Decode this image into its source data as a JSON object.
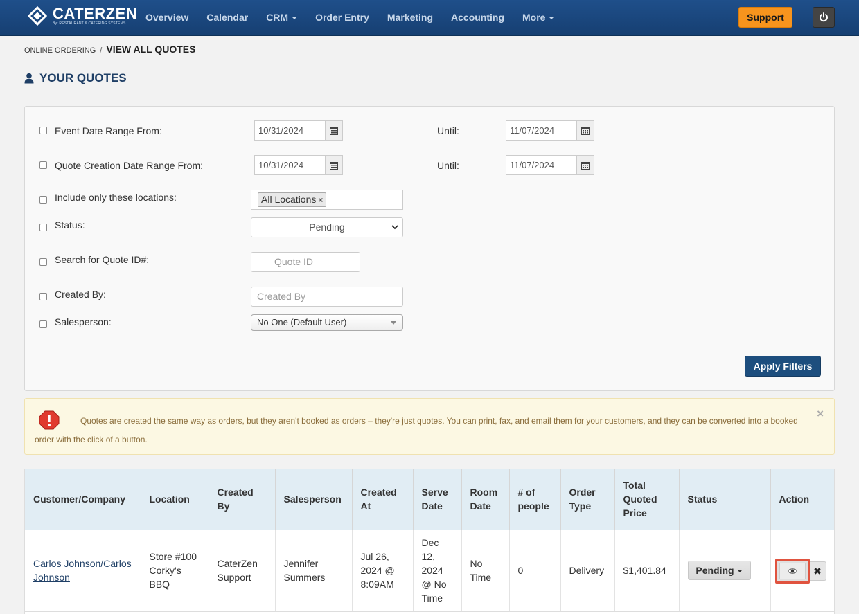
{
  "brand": {
    "name": "CATERZEN",
    "tagline": "By: RESTAURANT & CATERING SYSTEMS"
  },
  "nav": {
    "items": [
      {
        "label": "Overview",
        "dropdown": false
      },
      {
        "label": "Calendar",
        "dropdown": false
      },
      {
        "label": "CRM",
        "dropdown": true
      },
      {
        "label": "Order Entry",
        "dropdown": false
      },
      {
        "label": "Marketing",
        "dropdown": false
      },
      {
        "label": "Accounting",
        "dropdown": false
      },
      {
        "label": "More",
        "dropdown": true
      }
    ],
    "support_label": "Support"
  },
  "breadcrumb": {
    "parent": "ONLINE ORDERING",
    "separator": "/",
    "current": "VIEW ALL QUOTES"
  },
  "page_title": "YOUR QUOTES",
  "filters": {
    "event_date": {
      "label": "Event Date Range From:",
      "from": "10/31/2024",
      "until_label": "Until:",
      "until": "11/07/2024"
    },
    "creation_date": {
      "label": "Quote Creation Date Range From:",
      "from": "10/31/2024",
      "until_label": "Until:",
      "until": "11/07/2024"
    },
    "locations": {
      "label": "Include only these locations:",
      "tag": "All Locations",
      "remove": "×"
    },
    "status": {
      "label": "Status:",
      "value": "Pending"
    },
    "quote_id": {
      "label": "Search for Quote ID#:",
      "placeholder": "Quote ID"
    },
    "created_by": {
      "label": "Created By:",
      "placeholder": "Created By"
    },
    "salesperson": {
      "label": "Salesperson:",
      "value": "No One (Default User)"
    },
    "apply_label": "Apply Filters"
  },
  "alert": {
    "text": "Quotes are created the same way as orders, but they aren't booked as orders – they're just quotes. You can print, fax, and email them for your customers, and they can be converted into a booked order with the click of a button.",
    "close": "×"
  },
  "table": {
    "headers": [
      "Customer/Company",
      "Location",
      "Created By",
      "Salesperson",
      "Created At",
      "Serve Date",
      "Room Date",
      "# of people",
      "Order Type",
      "Total Quoted Price",
      "Status",
      "Action"
    ],
    "rows": [
      {
        "customer": "Carlos Johnson/Carlos Johnson",
        "location": "Store #100 Corky's BBQ",
        "created_by": "CaterZen Support",
        "salesperson": "Jennifer Summers",
        "created_at": "Jul 26, 2024 @ 8:09AM",
        "serve_date": "Dec 12, 2024 @ No Time",
        "room_date": "No Time",
        "people": "0",
        "order_type": "Delivery",
        "total": "$1,401.84",
        "status": "Pending",
        "delete": "✖"
      }
    ]
  },
  "colors": {
    "nav_bg": "#1f4f8a",
    "support": "#f7941d",
    "apply": "#1d4e7e",
    "highlight": "#e0533f",
    "alert_bg": "#fcf8e3"
  }
}
